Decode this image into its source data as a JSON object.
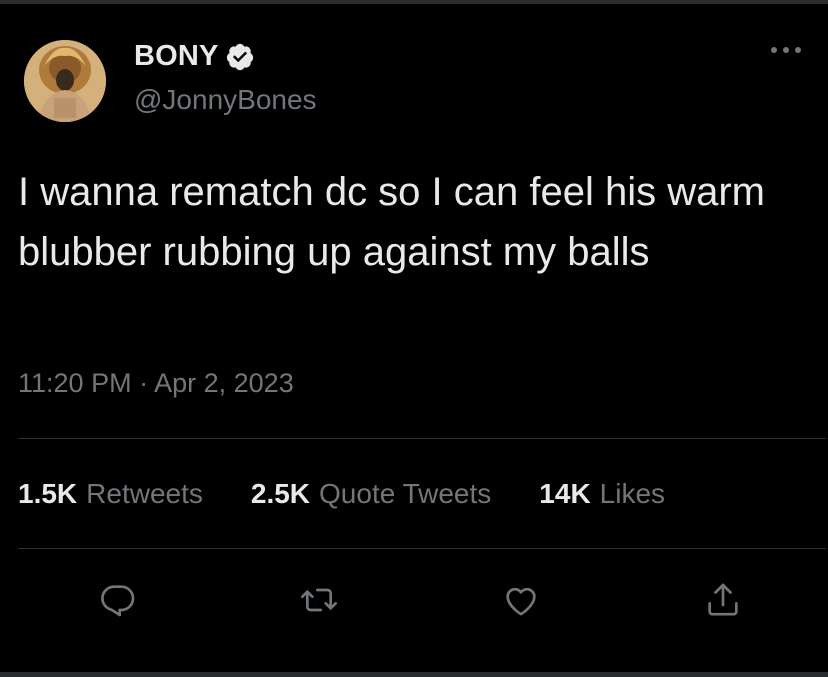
{
  "author": {
    "display_name": "BONY",
    "handle": "@JonnyBones",
    "verified": true,
    "avatar_icon": "profile-avatar"
  },
  "tweet": {
    "text": "I wanna rematch dc so I can feel his warm blubber rubbing up against my balls",
    "time": "11:20 PM",
    "separator": "·",
    "date": "Apr 2, 2023"
  },
  "stats": [
    {
      "count": "1.5K",
      "label": "Retweets"
    },
    {
      "count": "2.5K",
      "label": "Quote Tweets"
    },
    {
      "count": "14K",
      "label": "Likes"
    }
  ],
  "actions": [
    {
      "icon": "reply-icon"
    },
    {
      "icon": "retweet-icon"
    },
    {
      "icon": "like-icon"
    },
    {
      "icon": "share-icon"
    }
  ],
  "colors": {
    "background": "#000000",
    "primary_text": "#e7e9ea",
    "secondary_text": "#71767b",
    "divider": "#2f3336",
    "verified_badge": "#e7e9ea"
  }
}
